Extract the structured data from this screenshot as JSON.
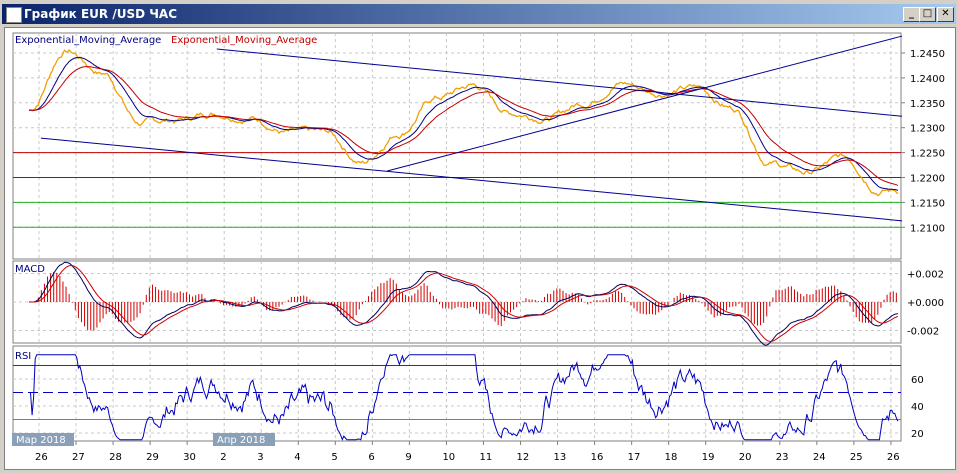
{
  "window": {
    "title": "График EUR /USD  ЧАС",
    "minimize": "_",
    "maximize": "□",
    "close": "✕"
  },
  "legend": {
    "ema1": "Exponential_Moving_Average",
    "ema2": "Exponential_Moving_Average"
  },
  "panels": {
    "macd": "MACD",
    "rsi": "RSI"
  },
  "month_badges": [
    "Мар 2018",
    "Апр 2018"
  ],
  "colors": {
    "price": "#f0a000",
    "ema_fast": "#000080",
    "ema_slow": "#c00000",
    "trend": "#000090",
    "resistance": "#c00000",
    "support": "#20b020"
  },
  "chart_data": {
    "type": "line",
    "symbol": "EUR/USD",
    "timeframe": "H1",
    "x_labels": [
      "26",
      "27",
      "28",
      "29",
      "30",
      "2",
      "3",
      "4",
      "5",
      "6",
      "9",
      "10",
      "11",
      "12",
      "13",
      "16",
      "17",
      "18",
      "19",
      "20",
      "23",
      "24",
      "25",
      "26"
    ],
    "price_keypoints": [
      1.2335,
      1.2455,
      1.241,
      1.231,
      1.2315,
      1.233,
      1.232,
      1.229,
      1.229,
      1.223,
      1.229,
      1.236,
      1.2385,
      1.233,
      1.232,
      1.235,
      1.239,
      1.237,
      1.238,
      1.234,
      1.223,
      1.221,
      1.224,
      1.2175
    ],
    "price_ticks": [
      "1.2450",
      "1.2400",
      "1.2350",
      "1.2300",
      "1.2250",
      "1.2200",
      "1.2150",
      "1.2100"
    ],
    "ylim": [
      1.207,
      1.2485
    ],
    "horizontal_lines": {
      "red": [
        1.225,
        1.22
      ],
      "green": [
        1.215,
        1.21
      ]
    },
    "trendlines": [
      {
        "from": [
          0.05,
          1.2279
        ],
        "to": [
          23.3,
          1.2113
        ]
      },
      {
        "from": [
          4.8,
          1.2458
        ],
        "to": [
          23.3,
          1.2323
        ]
      },
      {
        "from": [
          9.4,
          1.2213
        ],
        "to": [
          23.3,
          1.2484
        ]
      }
    ],
    "macd_ticks": [
      "+0.002",
      "+0.000",
      "-0.002"
    ],
    "rsi_ticks": [
      "60",
      "40",
      "20"
    ],
    "rsi_levels": [
      70,
      50,
      30
    ]
  }
}
